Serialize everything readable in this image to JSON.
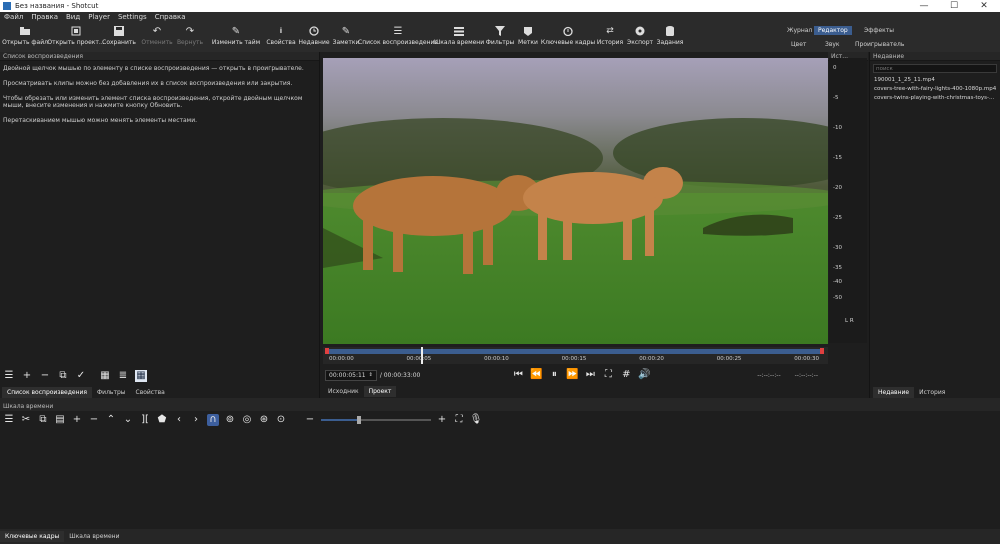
{
  "window": {
    "title": "Без названия - Shotcut",
    "min": "—",
    "max": "☐",
    "close": "✕"
  },
  "menu": [
    "Файл",
    "Правка",
    "Вид",
    "Player",
    "Settings",
    "Справка"
  ],
  "toolbar": [
    {
      "label": "Открыть файл",
      "icon": "folder-icon"
    },
    {
      "label": "Открыть проект...",
      "icon": "open-project-icon"
    },
    {
      "label": "Сохранить",
      "icon": "save-icon"
    },
    {
      "label": "Отменить",
      "icon": "undo-icon",
      "disabled": true
    },
    {
      "label": "Вернуть",
      "icon": "redo-icon",
      "disabled": true
    },
    {
      "label": "Изменить тайм",
      "icon": "pencil-icon"
    },
    {
      "label": "Свойства",
      "icon": "info-icon"
    },
    {
      "label": "Недавние",
      "icon": "clock-icon"
    },
    {
      "label": "Заметки",
      "icon": "notes-icon"
    },
    {
      "label": "Список воспроизведения",
      "icon": "list-icon"
    },
    {
      "label": "Шкала времени",
      "icon": "timeline-icon"
    },
    {
      "label": "Фильтры",
      "icon": "filter-icon"
    },
    {
      "label": "Метки",
      "icon": "marker-icon"
    },
    {
      "label": "Ключевые кадры",
      "icon": "stopwatch-icon"
    },
    {
      "label": "История",
      "icon": "history-icon"
    },
    {
      "label": "Экспорт",
      "icon": "export-icon"
    },
    {
      "label": "Задания",
      "icon": "jobs-icon"
    }
  ],
  "layouts": {
    "row1": [
      "Журнал",
      "Редактор",
      "Эффекты"
    ],
    "row2": [
      "Цвет",
      "Звук",
      "Проигрыватель"
    ],
    "active": "Редактор"
  },
  "playlist": {
    "title": "Список воспроизведения",
    "help": [
      "Двойной щелчок мышью по элементу в списке воспроизведения — открыть в проигрывателе.",
      "Просматривать клипы можно без добавления их в список воспроизведения или закрытия.",
      "Чтобы обрезать или изменить элемент списка воспроизведения, откройте двойным щелчком мыши, внесите изменения и нажмите кнопку Обновить.",
      "Перетаскиванием мышью можно менять элементы местами."
    ],
    "tabs": [
      "Список воспроизведения",
      "Фильтры",
      "Свойства"
    ]
  },
  "player": {
    "ruler": [
      "00:00:00",
      "00:00:05",
      "00:00:10",
      "00:00:15",
      "00:00:20",
      "00:00:25",
      "00:00:30"
    ],
    "position": "00:00:05:11",
    "duration": "/ 00:00:33:00",
    "in_point": "--:--:--:--",
    "out_point": "--:--:--:--",
    "tabs": [
      "Исходник",
      "Проект"
    ],
    "playhead": 0.19
  },
  "meter": {
    "title": "Ист...",
    "ticks": [
      "0",
      "-5",
      "-10",
      "-15",
      "-20",
      "-25",
      "-30",
      "-35",
      "-40",
      "-50"
    ],
    "channels": "L R"
  },
  "recent": {
    "title": "Недавние",
    "search_placeholder": "поиск",
    "items": [
      "190001_1_25_11.mp4",
      "covers-tree-with-fairy-lights-400-1080p.mp4",
      "covers-twins-playing-with-christmas-toys-..."
    ],
    "tabs": [
      "Недавние",
      "История"
    ]
  },
  "timeline": {
    "title": "Шкала времени",
    "tabs": [
      "Ключевые кадры",
      "Шкала времени"
    ]
  },
  "colors": {
    "accent": "#3b5d8f",
    "bg": "#1e1e1e",
    "panel": "#2b2b2b"
  }
}
